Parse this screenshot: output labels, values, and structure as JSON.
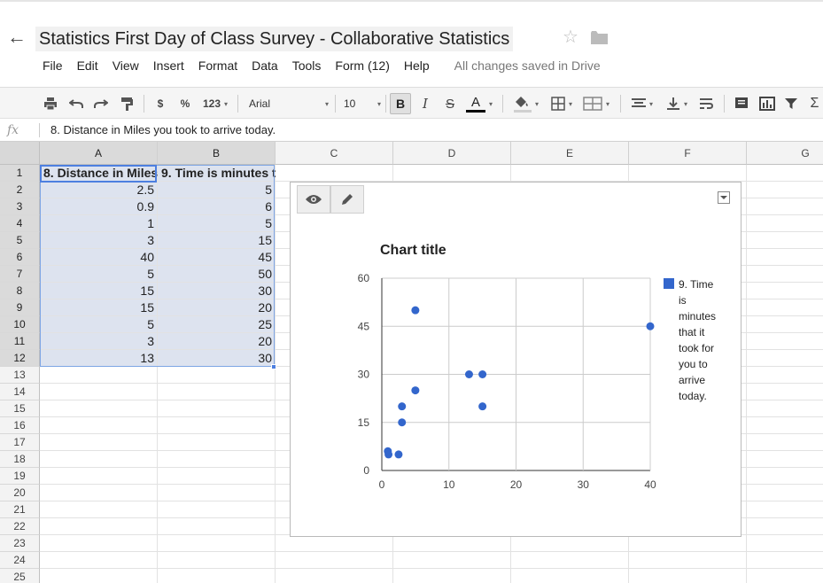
{
  "window": {
    "title": "Statistics First Day of Class Survey - Collaborative Statistics",
    "back_icon": "arrow-left-icon",
    "star_icon": "star-icon",
    "folder_icon": "folder-icon"
  },
  "menu": {
    "items": [
      "File",
      "Edit",
      "View",
      "Insert",
      "Format",
      "Data",
      "Tools",
      "Form (12)",
      "Help"
    ],
    "status": "All changes saved in Drive"
  },
  "toolbar": {
    "currency": "$",
    "percent": "%",
    "more_formats": "123",
    "font": "Arial",
    "font_size": "10",
    "bold": "B",
    "italic": "I",
    "strike": "S",
    "text_color": "A"
  },
  "formula_bar": {
    "fx": "fx",
    "value": "8. Distance in Miles you took to arrive today."
  },
  "grid": {
    "columns": [
      "A",
      "B",
      "C",
      "D",
      "E",
      "F",
      "G"
    ],
    "rows": [
      "1",
      "2",
      "3",
      "4",
      "5",
      "6",
      "7",
      "8",
      "9",
      "10",
      "11",
      "12",
      "13",
      "14",
      "15",
      "16",
      "17",
      "18",
      "19",
      "20",
      "21",
      "22",
      "23",
      "24",
      "25"
    ],
    "headers": [
      "8. Distance in Miles you took to arrive today.",
      "9. Time is minutes that it took for you to arrive today."
    ],
    "data": [
      [
        "2.5",
        "5"
      ],
      [
        "0.9",
        "6"
      ],
      [
        "1",
        "5"
      ],
      [
        "3",
        "15"
      ],
      [
        "40",
        "45"
      ],
      [
        "5",
        "50"
      ],
      [
        "15",
        "30"
      ],
      [
        "15",
        "20"
      ],
      [
        "5",
        "25"
      ],
      [
        "3",
        "20"
      ],
      [
        "13",
        "30"
      ]
    ]
  },
  "chart": {
    "view_icon": "eye-icon",
    "edit_icon": "pencil-icon",
    "menu_icon": "dropdown-menu-icon"
  },
  "chart_data": {
    "type": "scatter",
    "title": "Chart title",
    "xlabel": "",
    "ylabel": "",
    "xlim": [
      0,
      40
    ],
    "ylim": [
      0,
      60
    ],
    "xticks": [
      "0",
      "10",
      "20",
      "30",
      "40"
    ],
    "yticks": [
      "0",
      "15",
      "30",
      "45",
      "60"
    ],
    "grid": true,
    "legend_position": "right",
    "series": [
      {
        "name": "9. Time is minutes that it took for you to arrive today.",
        "legend_lines": [
          "9. Time",
          "is",
          "minutes",
          "that it",
          "took for",
          "you to",
          "arrive",
          "today."
        ],
        "color": "#3366cc",
        "x": [
          2.5,
          0.9,
          1,
          3,
          40,
          5,
          15,
          15,
          5,
          3,
          13
        ],
        "y": [
          5,
          6,
          5,
          15,
          45,
          50,
          30,
          20,
          25,
          20,
          30
        ]
      }
    ]
  }
}
